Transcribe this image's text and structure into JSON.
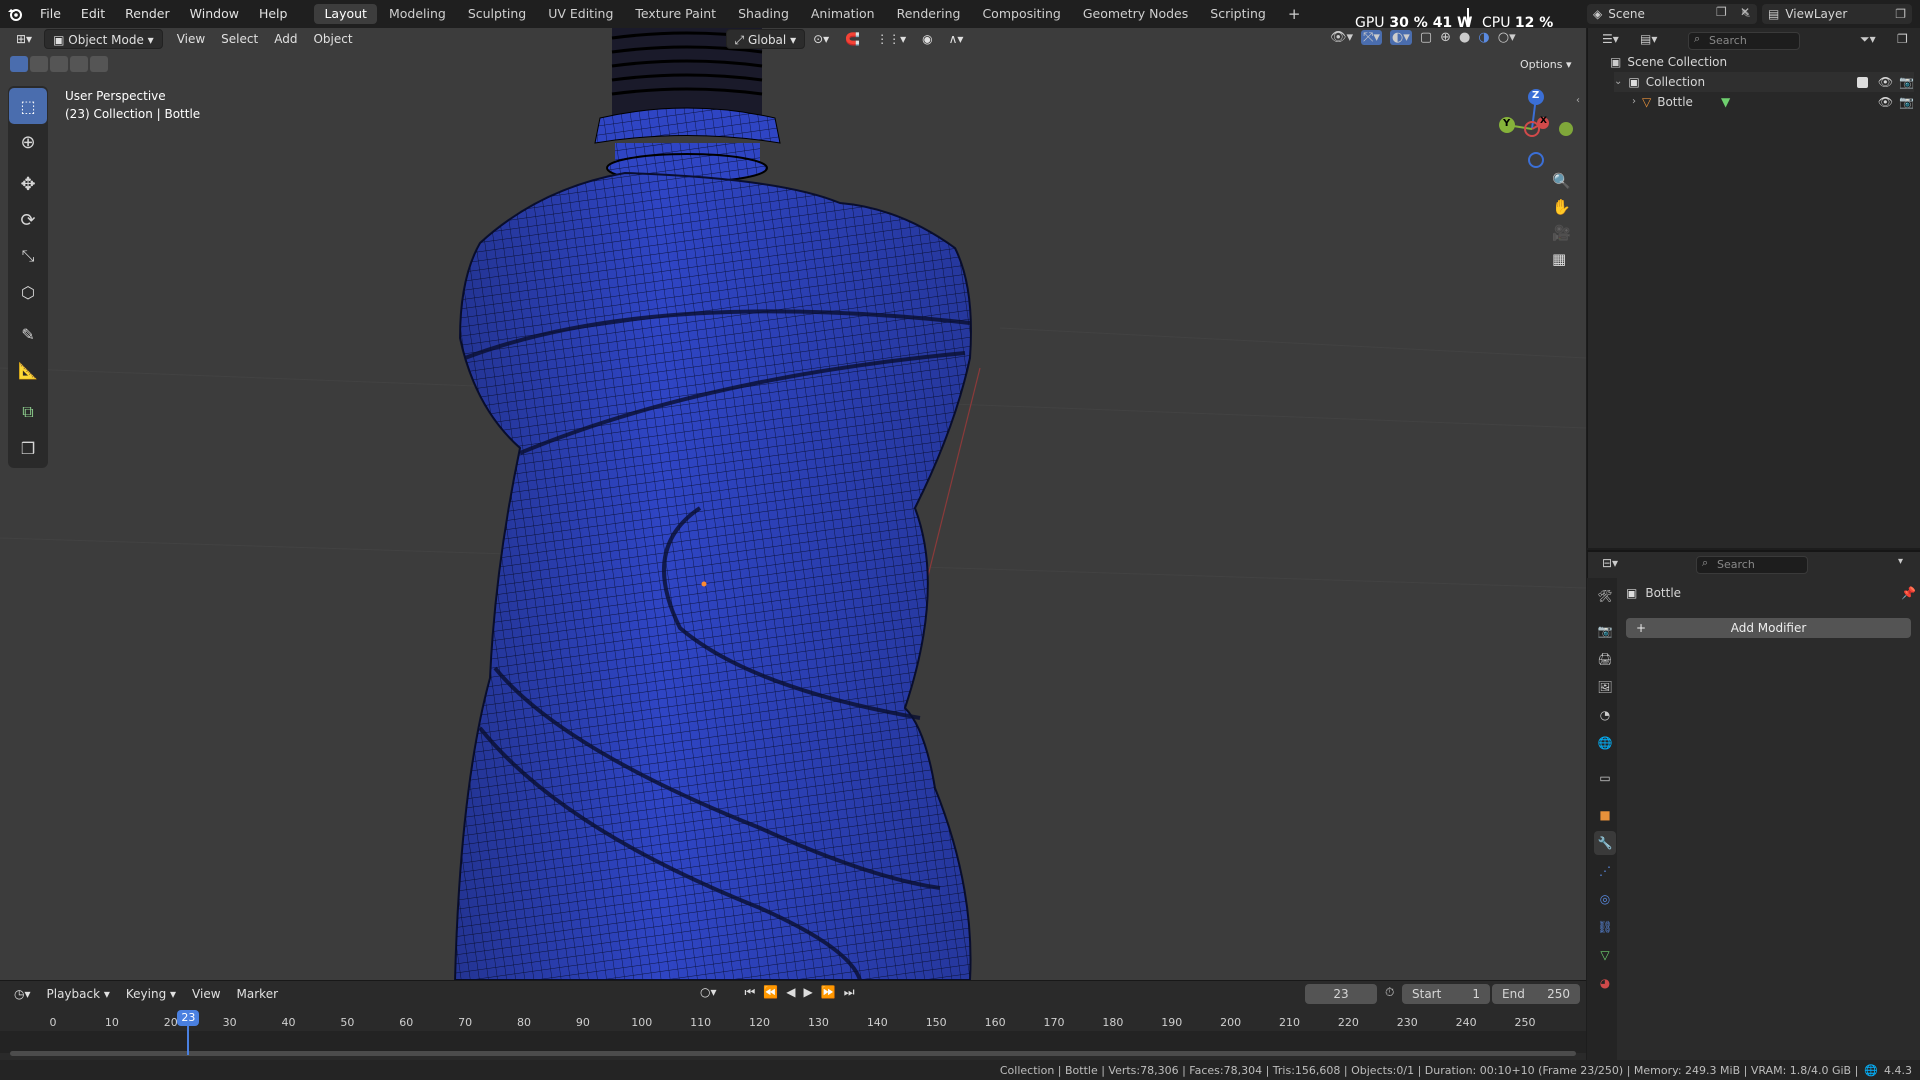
{
  "topbar": {
    "menus": [
      "File",
      "Edit",
      "Render",
      "Window",
      "Help"
    ],
    "workspaces": [
      "Layout",
      "Modeling",
      "Sculpting",
      "UV Editing",
      "Texture Paint",
      "Shading",
      "Animation",
      "Rendering",
      "Compositing",
      "Geometry Nodes",
      "Scripting"
    ],
    "active_workspace": "Layout",
    "add_tab": "+",
    "gpu_label": "GPU",
    "gpu_value": "30 %",
    "gpu_watts": "41 W",
    "cpu_label": "CPU",
    "cpu_value": "12 %",
    "scene_name": "Scene",
    "view_layer": "ViewLayer"
  },
  "viewport_header": {
    "mode": "Object Mode",
    "menus": [
      "View",
      "Select",
      "Add",
      "Object"
    ],
    "transform_orientation": "Global",
    "options": "Options"
  },
  "viewport": {
    "view_name": "User Perspective",
    "context": "(23) Collection | Bottle",
    "gizmo": {
      "z": "Z",
      "y": "Y",
      "x": "X"
    },
    "mesh_color": "#2f45c4",
    "background_color": "#3c3c3c"
  },
  "outliner": {
    "search_placeholder": "Search",
    "scene_collection": "Scene Collection",
    "collection": "Collection",
    "object": "Bottle"
  },
  "properties": {
    "search_placeholder": "Search",
    "object_name": "Bottle",
    "add_modifier": "Add Modifier"
  },
  "timeline": {
    "menus": [
      "Playback",
      "Keying",
      "View",
      "Marker"
    ],
    "current_frame": "23",
    "start_label": "Start",
    "start_value": "1",
    "end_label": "End",
    "end_value": "250",
    "ticks": [
      "0",
      "10",
      "20",
      "30",
      "40",
      "50",
      "60",
      "70",
      "80",
      "90",
      "100",
      "110",
      "120",
      "130",
      "140",
      "150",
      "160",
      "170",
      "180",
      "190",
      "200",
      "210",
      "220",
      "230",
      "240",
      "250"
    ]
  },
  "statusbar": {
    "text": "Collection | Bottle | Verts:78,306 | Faces:78,304 | Tris:156,608 | Objects:0/1 | Duration: 00:10+10 (Frame 23/250) | Memory: 249.3 MiB | VRAM: 1.8/4.0 GiB |",
    "version": "4.4.3"
  }
}
